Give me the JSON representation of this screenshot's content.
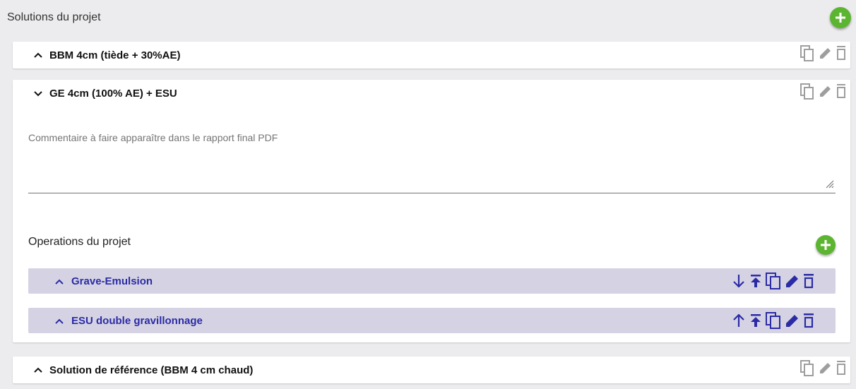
{
  "header": {
    "title": "Solutions du projet"
  },
  "colors": {
    "accent_green": "#5cb531",
    "operation_bg": "#d5d3e3",
    "operation_text": "#2b2ba6",
    "icon_grey": "#9e9e9e"
  },
  "solutions": [
    {
      "label": "BBM 4cm (tiède + 30%AE)",
      "expanded": false
    },
    {
      "label": "GE 4cm (100% AE) + ESU",
      "expanded": true
    },
    {
      "label": "Solution de référence (BBM 4 cm chaud)",
      "expanded": false
    }
  ],
  "expanded_solution": {
    "comment_placeholder": "Commentaire à faire apparaître dans le rapport final PDF",
    "operations_title": "Operations du projet",
    "operations": [
      {
        "label": "Grave-Emulsion",
        "move_icon": "arrow-down-icon"
      },
      {
        "label": "ESU double gravillonnage",
        "move_icon": "arrow-up-icon"
      }
    ]
  },
  "icons": {
    "add": "plus-icon",
    "copy": "copy-icon",
    "edit": "pencil-icon",
    "delete": "trash-icon",
    "to_top": "move-to-top-icon",
    "chevron_up": "chevron-up-icon",
    "chevron_down": "chevron-down-icon",
    "resize": "resize-handle-icon"
  }
}
